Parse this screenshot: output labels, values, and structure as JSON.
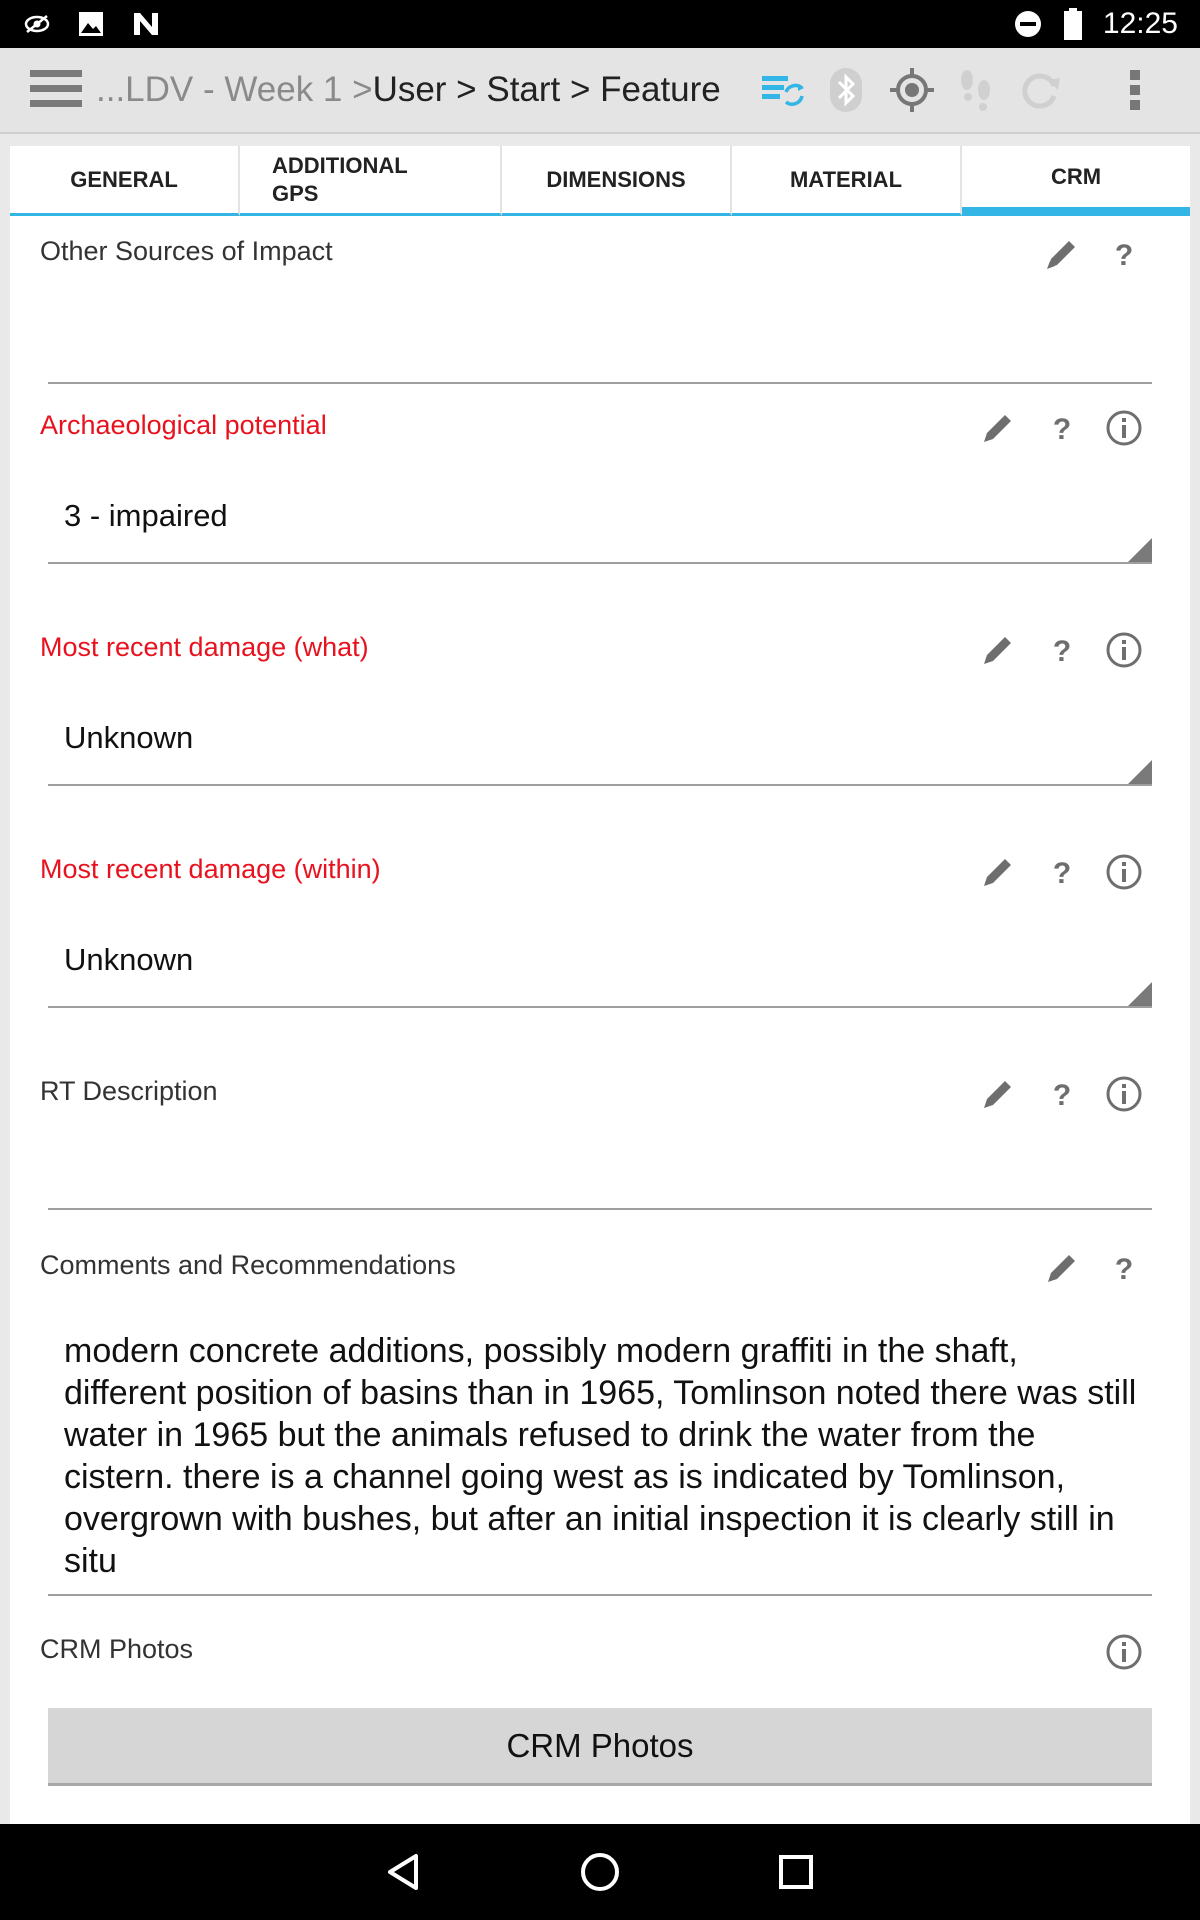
{
  "status_bar": {
    "time": "12:25",
    "left_icons": [
      "eye-icon",
      "image-icon",
      "n-logo-icon"
    ],
    "right_icons": [
      "do-not-disturb-icon",
      "battery-icon"
    ]
  },
  "toolbar": {
    "menu_icon": "menu-icon",
    "breadcrumb_prefix": "...LDV - Week 1 > ",
    "breadcrumb_path": "User > Start > Feature",
    "icons": [
      "sync-list-icon",
      "bluetooth-icon",
      "gps-target-icon",
      "footsteps-icon",
      "refresh-icon",
      "overflow-menu-icon"
    ]
  },
  "tabs": [
    {
      "label": "GENERAL",
      "active": false
    },
    {
      "label": "ADDITIONAL GPS",
      "active": false
    },
    {
      "label": "DIMENSIONS",
      "active": false
    },
    {
      "label": "MATERIAL",
      "active": false
    },
    {
      "label": "CRM",
      "active": true
    }
  ],
  "fields": {
    "other_sources": {
      "label": "Other Sources of Impact",
      "value": ""
    },
    "archaeological_potential": {
      "label": "Archaeological potential",
      "value": "3 - impaired"
    },
    "damage_what": {
      "label": "Most recent damage (what)",
      "value": "Unknown"
    },
    "damage_within": {
      "label": "Most recent damage (within)",
      "value": "Unknown"
    },
    "rt_description": {
      "label": "RT Description",
      "value": ""
    },
    "comments": {
      "label": "Comments and Recommendations",
      "value": "modern concrete additions, possibly modern graffiti in the shaft, different position of basins than in 1965, Tomlinson noted there was still water in 1965 but the animals refused to drink the water from the cistern. there is a channel going west as is indicated by Tomlinson, overgrown with bushes, but after an initial inspection it is clearly still in situ"
    },
    "crm_photos": {
      "label": "CRM Photos",
      "button_label": "CRM Photos"
    }
  },
  "colors": {
    "accent": "#33b5e5",
    "required_label": "#e8121e",
    "icon_gray": "#6e6e6e"
  },
  "nav_bar": {
    "icons": [
      "back-icon",
      "home-icon",
      "recents-icon"
    ]
  }
}
